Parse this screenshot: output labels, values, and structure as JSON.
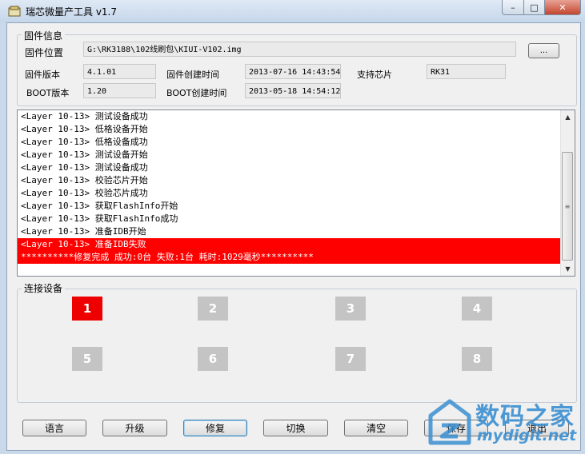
{
  "window": {
    "title": "瑞芯微量产工具 v1.7",
    "min": "–",
    "max": "□",
    "close": "✕"
  },
  "firmware": {
    "group_title": "固件信息",
    "location_label": "固件位置",
    "location_value": "G:\\RK3188\\102线刷包\\KIUI-V102.img",
    "browse_label": "...",
    "version_label": "固件版本",
    "version_value": "4.1.01",
    "created_label": "固件创建时间",
    "created_value": "2013-07-16 14:43:54",
    "chip_label": "支持芯片",
    "chip_value": "RK31",
    "boot_version_label": "BOOT版本",
    "boot_version_value": "1.20",
    "boot_created_label": "BOOT创建时间",
    "boot_created_value": "2013-05-18 14:54:12"
  },
  "log": {
    "lines": [
      "<Layer 10-13> 测试设备成功",
      "<Layer 10-13> 低格设备开始",
      "<Layer 10-13> 低格设备成功",
      "<Layer 10-13> 测试设备开始",
      "<Layer 10-13> 测试设备成功",
      "<Layer 10-13> 校验芯片开始",
      "<Layer 10-13> 校验芯片成功",
      "<Layer 10-13> 获取FlashInfo开始",
      "<Layer 10-13> 获取FlashInfo成功",
      "<Layer 10-13> 准备IDB开始",
      "<Layer 10-13> 准备IDB失败",
      "**********修复完成 成功:0台 失败:1台 耗时:1029毫秒**********"
    ],
    "error_lines": [
      10,
      11
    ]
  },
  "devices": {
    "group_title": "连接设备",
    "slots": [
      {
        "label": "1",
        "active": true
      },
      {
        "label": "2",
        "active": false
      },
      {
        "label": "3",
        "active": false
      },
      {
        "label": "4",
        "active": false
      },
      {
        "label": "5",
        "active": false
      },
      {
        "label": "6",
        "active": false
      },
      {
        "label": "7",
        "active": false
      },
      {
        "label": "8",
        "active": false
      }
    ],
    "active_color": "#ee0000",
    "inactive_color": "#c4c4c4"
  },
  "buttons": {
    "language": "语言",
    "upgrade": "升级",
    "repair": "修复",
    "switch": "切换",
    "clear": "清空",
    "save": "保存",
    "exit": "退出"
  },
  "watermark": {
    "text_cn": "数码之家",
    "text_en": "mydigit.net"
  }
}
